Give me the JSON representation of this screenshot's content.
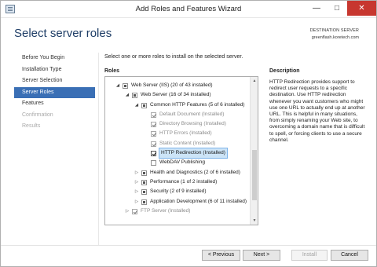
{
  "window": {
    "title": "Add Roles and Features Wizard",
    "minimize_glyph": "—",
    "maximize_glyph": "□",
    "close_glyph": "✕"
  },
  "header": {
    "title": "Select server roles",
    "destination_label": "DESTINATION SERVER",
    "destination_server": "greenflash.koretech.com"
  },
  "nav": {
    "items": [
      {
        "label": "Before You Begin",
        "state": "normal"
      },
      {
        "label": "Installation Type",
        "state": "normal"
      },
      {
        "label": "Server Selection",
        "state": "normal"
      },
      {
        "label": "Server Roles",
        "state": "active"
      },
      {
        "label": "Features",
        "state": "normal"
      },
      {
        "label": "Confirmation",
        "state": "disabled"
      },
      {
        "label": "Results",
        "state": "disabled"
      }
    ]
  },
  "content": {
    "instruction": "Select one or more roles to install on the selected server.",
    "roles_heading": "Roles",
    "description_heading": "Description",
    "description_text": "HTTP Redirection provides support to redirect user requests to a specific destination. Use HTTP redirection whenever you want customers who might use one URL to actually end up at another URL. This is helpful in many situations, from simply renaming your Web site, to overcoming a domain name that is difficult to spell, or forcing clients to use a secure channel."
  },
  "roles_tree": [
    {
      "label": "Web Server (IIS) (20 of 43 installed)",
      "level": 0,
      "expander": "◢",
      "check": "partial"
    },
    {
      "label": "Web Server (16 of 34 installed)",
      "level": 1,
      "expander": "◢",
      "check": "partial"
    },
    {
      "label": "Common HTTP Features (5 of 6 installed)",
      "level": 2,
      "expander": "◢",
      "check": "partial"
    },
    {
      "label": "Default Document (Installed)",
      "level": 3,
      "expander": "",
      "check": "checked-installed"
    },
    {
      "label": "Directory Browsing (Installed)",
      "level": 3,
      "expander": "",
      "check": "checked-installed"
    },
    {
      "label": "HTTP Errors (Installed)",
      "level": 3,
      "expander": "",
      "check": "checked-installed"
    },
    {
      "label": "Static Content (Installed)",
      "level": 3,
      "expander": "",
      "check": "checked-installed"
    },
    {
      "label": "HTTP Redirection (Installed)",
      "level": 3,
      "expander": "",
      "check": "checked-selected"
    },
    {
      "label": "WebDAV Publishing",
      "level": 3,
      "expander": "",
      "check": "unchecked"
    },
    {
      "label": "Health and Diagnostics (2 of 6 installed)",
      "level": 2,
      "expander": "▷",
      "check": "partial"
    },
    {
      "label": "Performance (1 of 2 installed)",
      "level": 2,
      "expander": "▷",
      "check": "partial"
    },
    {
      "label": "Security (2 of 9 installed)",
      "level": 2,
      "expander": "▷",
      "check": "partial"
    },
    {
      "label": "Application Development (6 of 11 installed)",
      "level": 2,
      "expander": "▷",
      "check": "partial"
    },
    {
      "label": "FTP Server (Installed)",
      "level": 1,
      "expander": "▷",
      "check": "checked-installed"
    }
  ],
  "scrollbar": {
    "up_glyph": "▲",
    "down_glyph": "▼"
  },
  "footer": {
    "previous": "< Previous",
    "next": "Next >",
    "install": "Install",
    "cancel": "Cancel"
  }
}
